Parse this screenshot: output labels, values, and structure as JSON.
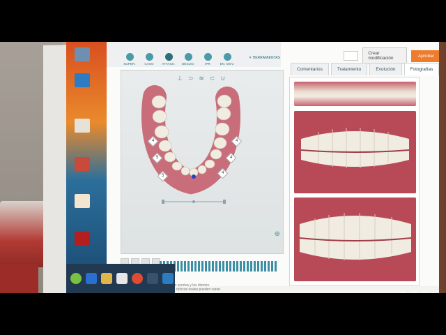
{
  "toolbar": {
    "tools": [
      {
        "label": "SUPER."
      },
      {
        "label": "CASO"
      },
      {
        "label": "ATTACH."
      },
      {
        "label": "DESLIN."
      },
      {
        "label": "IPR"
      },
      {
        "label": "EN. MOV."
      }
    ],
    "tools_menu_label": "HERRAMIENTAS"
  },
  "header": {
    "modify_button": "Crear modificación",
    "approve_button": "Aprobar"
  },
  "tabs": [
    {
      "label": "Comentarios"
    },
    {
      "label": "Tratamiento"
    },
    {
      "label": "Evolución"
    },
    {
      "label": "Fotografías"
    }
  ],
  "viewer": {
    "ipr_values": [
      "4",
      "5",
      "5",
      "4",
      "4",
      "4"
    ]
  },
  "status": {
    "line1": "... simulados de la sonrisa y los dientes.",
    "line2": "... Los resultados clínicos reales pueden variar"
  },
  "colors": {
    "accent": "#2d6f7d",
    "approve": "#ef7c2c",
    "gum": "#c96d7a",
    "tooth": "#f1ece1"
  }
}
